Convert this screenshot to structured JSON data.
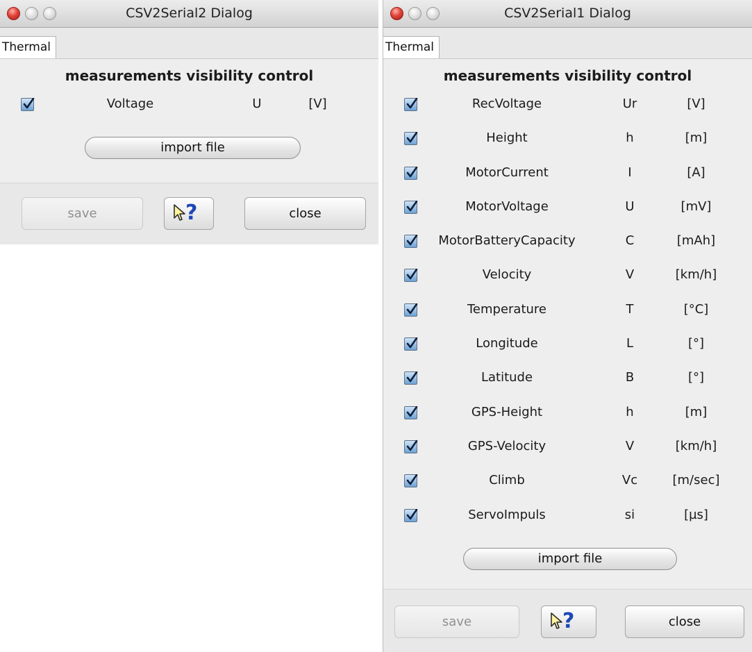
{
  "dialog2": {
    "title": "CSV2Serial2 Dialog",
    "tab": "Thermal",
    "heading": "measurements visibility control",
    "rows": [
      {
        "name": "Voltage",
        "symbol": "U",
        "unit": "[V]",
        "checked": true
      }
    ],
    "import_label": "import file",
    "save_label": "save",
    "close_label": "close",
    "help_icon": "help-arrow-question-icon"
  },
  "dialog1": {
    "title": "CSV2Serial1 Dialog",
    "tab": "Thermal",
    "heading": "measurements visibility control",
    "rows": [
      {
        "name": "RecVoltage",
        "symbol": "Ur",
        "unit": "[V]",
        "checked": true
      },
      {
        "name": "Height",
        "symbol": "h",
        "unit": "[m]",
        "checked": true
      },
      {
        "name": "MotorCurrent",
        "symbol": "I",
        "unit": "[A]",
        "checked": true
      },
      {
        "name": "MotorVoltage",
        "symbol": "U",
        "unit": "[mV]",
        "checked": true
      },
      {
        "name": "MotorBatteryCapacity",
        "symbol": "C",
        "unit": "[mAh]",
        "checked": true
      },
      {
        "name": "Velocity",
        "symbol": "V",
        "unit": "[km/h]",
        "checked": true
      },
      {
        "name": "Temperature",
        "symbol": "T",
        "unit": "[°C]",
        "checked": true
      },
      {
        "name": "Longitude",
        "symbol": "L",
        "unit": "[°]",
        "checked": true
      },
      {
        "name": "Latitude",
        "symbol": "B",
        "unit": "[°]",
        "checked": true
      },
      {
        "name": "GPS-Height",
        "symbol": "h",
        "unit": "[m]",
        "checked": true
      },
      {
        "name": "GPS-Velocity",
        "symbol": "V",
        "unit": "[km/h]",
        "checked": true
      },
      {
        "name": "Climb",
        "symbol": "Vc",
        "unit": "[m/sec]",
        "checked": true
      },
      {
        "name": "ServoImpuls",
        "symbol": "si",
        "unit": "[µs]",
        "checked": true
      }
    ],
    "import_label": "import file",
    "save_label": "save",
    "close_label": "close",
    "help_icon": "help-arrow-question-icon"
  },
  "colors": {
    "close_light": "#e0443a",
    "checkbox": "#6ea2d4",
    "help_question": "#1d47b8",
    "window_bg": "#e8e8e8"
  }
}
